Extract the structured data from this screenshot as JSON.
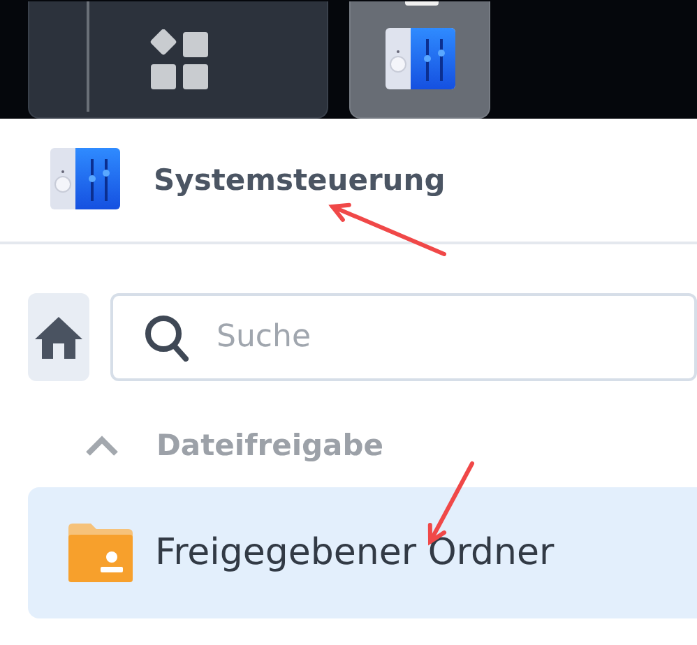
{
  "taskbar": {
    "items": [
      {
        "kind": "apps",
        "selected": false
      },
      {
        "kind": "control-panel",
        "selected": true
      }
    ]
  },
  "window": {
    "title": "Systemsteuerung"
  },
  "search": {
    "placeholder": "Suche"
  },
  "sidebar": {
    "section": {
      "label": "Dateifreigabe",
      "expanded": true
    },
    "items": [
      {
        "label": "Freigegebener Ordner",
        "selected": true
      }
    ]
  },
  "annotations": [
    {
      "kind": "arrow"
    },
    {
      "kind": "arrow"
    }
  ]
}
